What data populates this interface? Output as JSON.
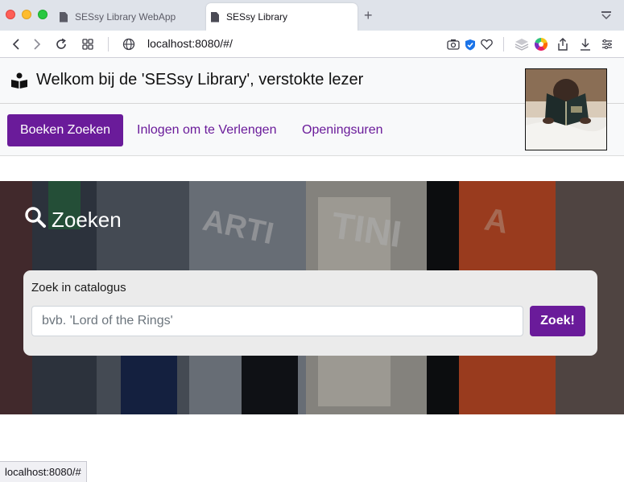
{
  "browser": {
    "tabs": [
      {
        "label": "SESsy Library WebApp",
        "active": false
      },
      {
        "label": "SESsy Library",
        "active": true
      }
    ],
    "url": "localhost:8080/#/",
    "status_url": "localhost:8080/#",
    "icons": [
      "back-icon",
      "forward-icon",
      "reload-icon",
      "tab-grid-icon",
      "site-info-icon",
      "screenshot-icon",
      "shield-icon",
      "heart-icon",
      "layers-icon",
      "color-wheel-icon",
      "share-icon",
      "download-icon",
      "menu-icon"
    ]
  },
  "header": {
    "title": "Welkom bij de 'SESsy Library', verstokte lezer",
    "icon": "reader-icon"
  },
  "nav": {
    "items": [
      {
        "label": "Boeken Zoeken",
        "active": true
      },
      {
        "label": "Inlogen om te Verlengen",
        "active": false
      },
      {
        "label": "Openingsuren",
        "active": false
      }
    ]
  },
  "search": {
    "heading": "Zoeken",
    "heading_icon": "search-icon",
    "label": "Zoek in catalogus",
    "placeholder": "bvb. 'Lord of the Rings'",
    "value": "",
    "button_label": "Zoek!"
  },
  "colors": {
    "accent": "#6a1b9a",
    "header_bg": "#f8f9fa",
    "card_bg": "#ebebeb"
  }
}
